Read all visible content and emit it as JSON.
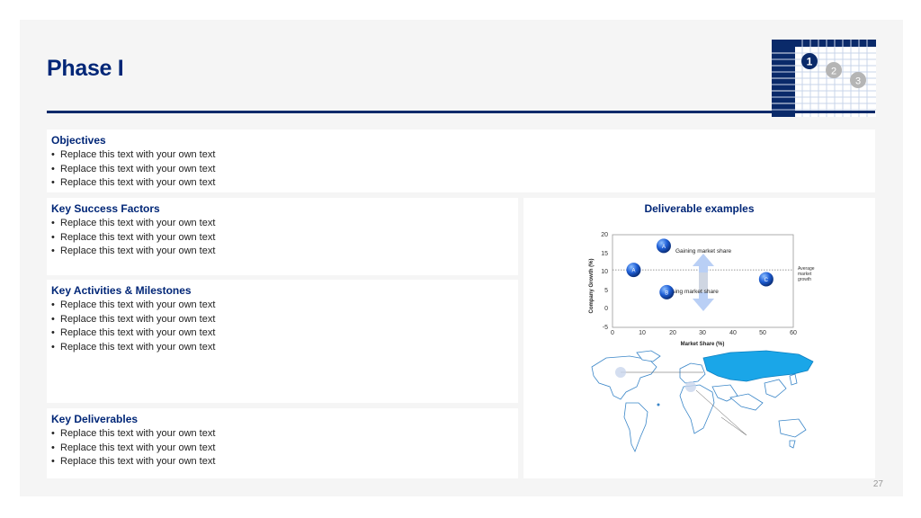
{
  "slide": {
    "title": "Phase I",
    "page_number": "27",
    "phase_indicator": {
      "steps": [
        "1",
        "2",
        "3"
      ],
      "active": "1"
    }
  },
  "objectives": {
    "heading": "Objectives",
    "items": [
      "Replace this text with your own text",
      "Replace this text with your own text",
      "Replace this text with your own text"
    ]
  },
  "key_success_factors": {
    "heading": "Key Success Factors",
    "items": [
      "Replace this text with your own text",
      "Replace this text with your own text",
      "Replace this text with your own text"
    ]
  },
  "key_activities": {
    "heading": "Key Activities & Milestones",
    "items": [
      "Replace this text with your own text",
      "Replace this text with your own text",
      "Replace this text with your own text",
      "Replace this text with your own text"
    ]
  },
  "key_deliverables": {
    "heading": "Key Deliverables",
    "items": [
      "Replace this text with your own text",
      "Replace this text with your own text",
      "Replace this text with your own text"
    ]
  },
  "deliverable_examples": {
    "heading": "Deliverable examples",
    "chart": {
      "ylabel": "Company Growth (%)",
      "xlabel": "Market Share (%)",
      "yticks": [
        "20",
        "15",
        "10",
        "5",
        "0",
        "-5"
      ],
      "xticks": [
        "0",
        "10",
        "20",
        "30",
        "40",
        "50",
        "60"
      ],
      "annotation_top": "Gaining market share",
      "annotation_bottom": "Losing market share",
      "avg_line_label": [
        "Average",
        "market",
        "growth"
      ]
    }
  },
  "chart_data": {
    "type": "scatter",
    "xlabel": "Market Share (%)",
    "ylabel": "Company Growth (%)",
    "xlim": [
      0,
      60
    ],
    "ylim": [
      -5,
      20
    ],
    "average_market_growth": 10.5,
    "points": [
      {
        "label": "A",
        "x": 17,
        "y": 17
      },
      {
        "label": "A",
        "x": 7,
        "y": 10.5
      },
      {
        "label": "B",
        "x": 18,
        "y": 4.5
      },
      {
        "label": "C",
        "x": 51,
        "y": 8
      }
    ],
    "colors": {
      "bubble": "#1f5fd6",
      "bubble_light": "#6fa8ff",
      "arrow": "#b9cff5"
    }
  }
}
